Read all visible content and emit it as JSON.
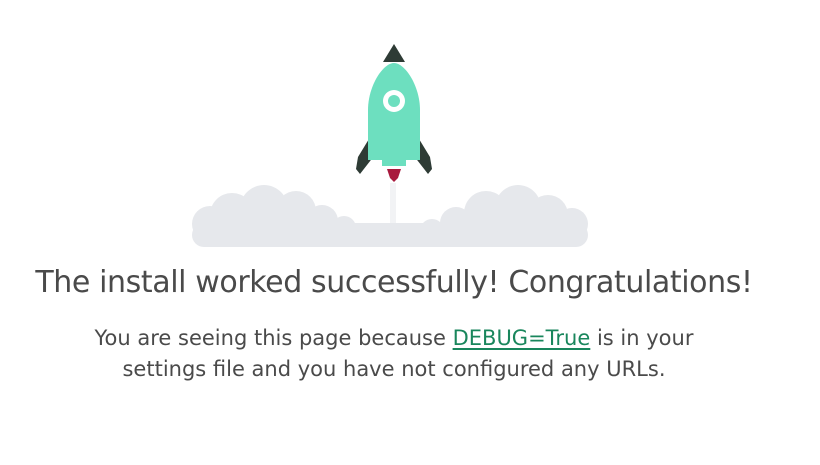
{
  "heading": "The install worked successfully! Congratulations!",
  "description": {
    "before_link": "You are seeing this page because ",
    "link_text": "DEBUG=True",
    "after_link": " is in your",
    "line2": "settings file and you have not configured any URLs."
  },
  "illustration": {
    "rocket_body_color": "#6ddfbf",
    "rocket_fin_color": "#2e3b35",
    "flame_color": "#a8193d",
    "cloud_color": "#e6e8ec"
  },
  "colors": {
    "link": "#19865c",
    "text": "#4a4a4a"
  }
}
